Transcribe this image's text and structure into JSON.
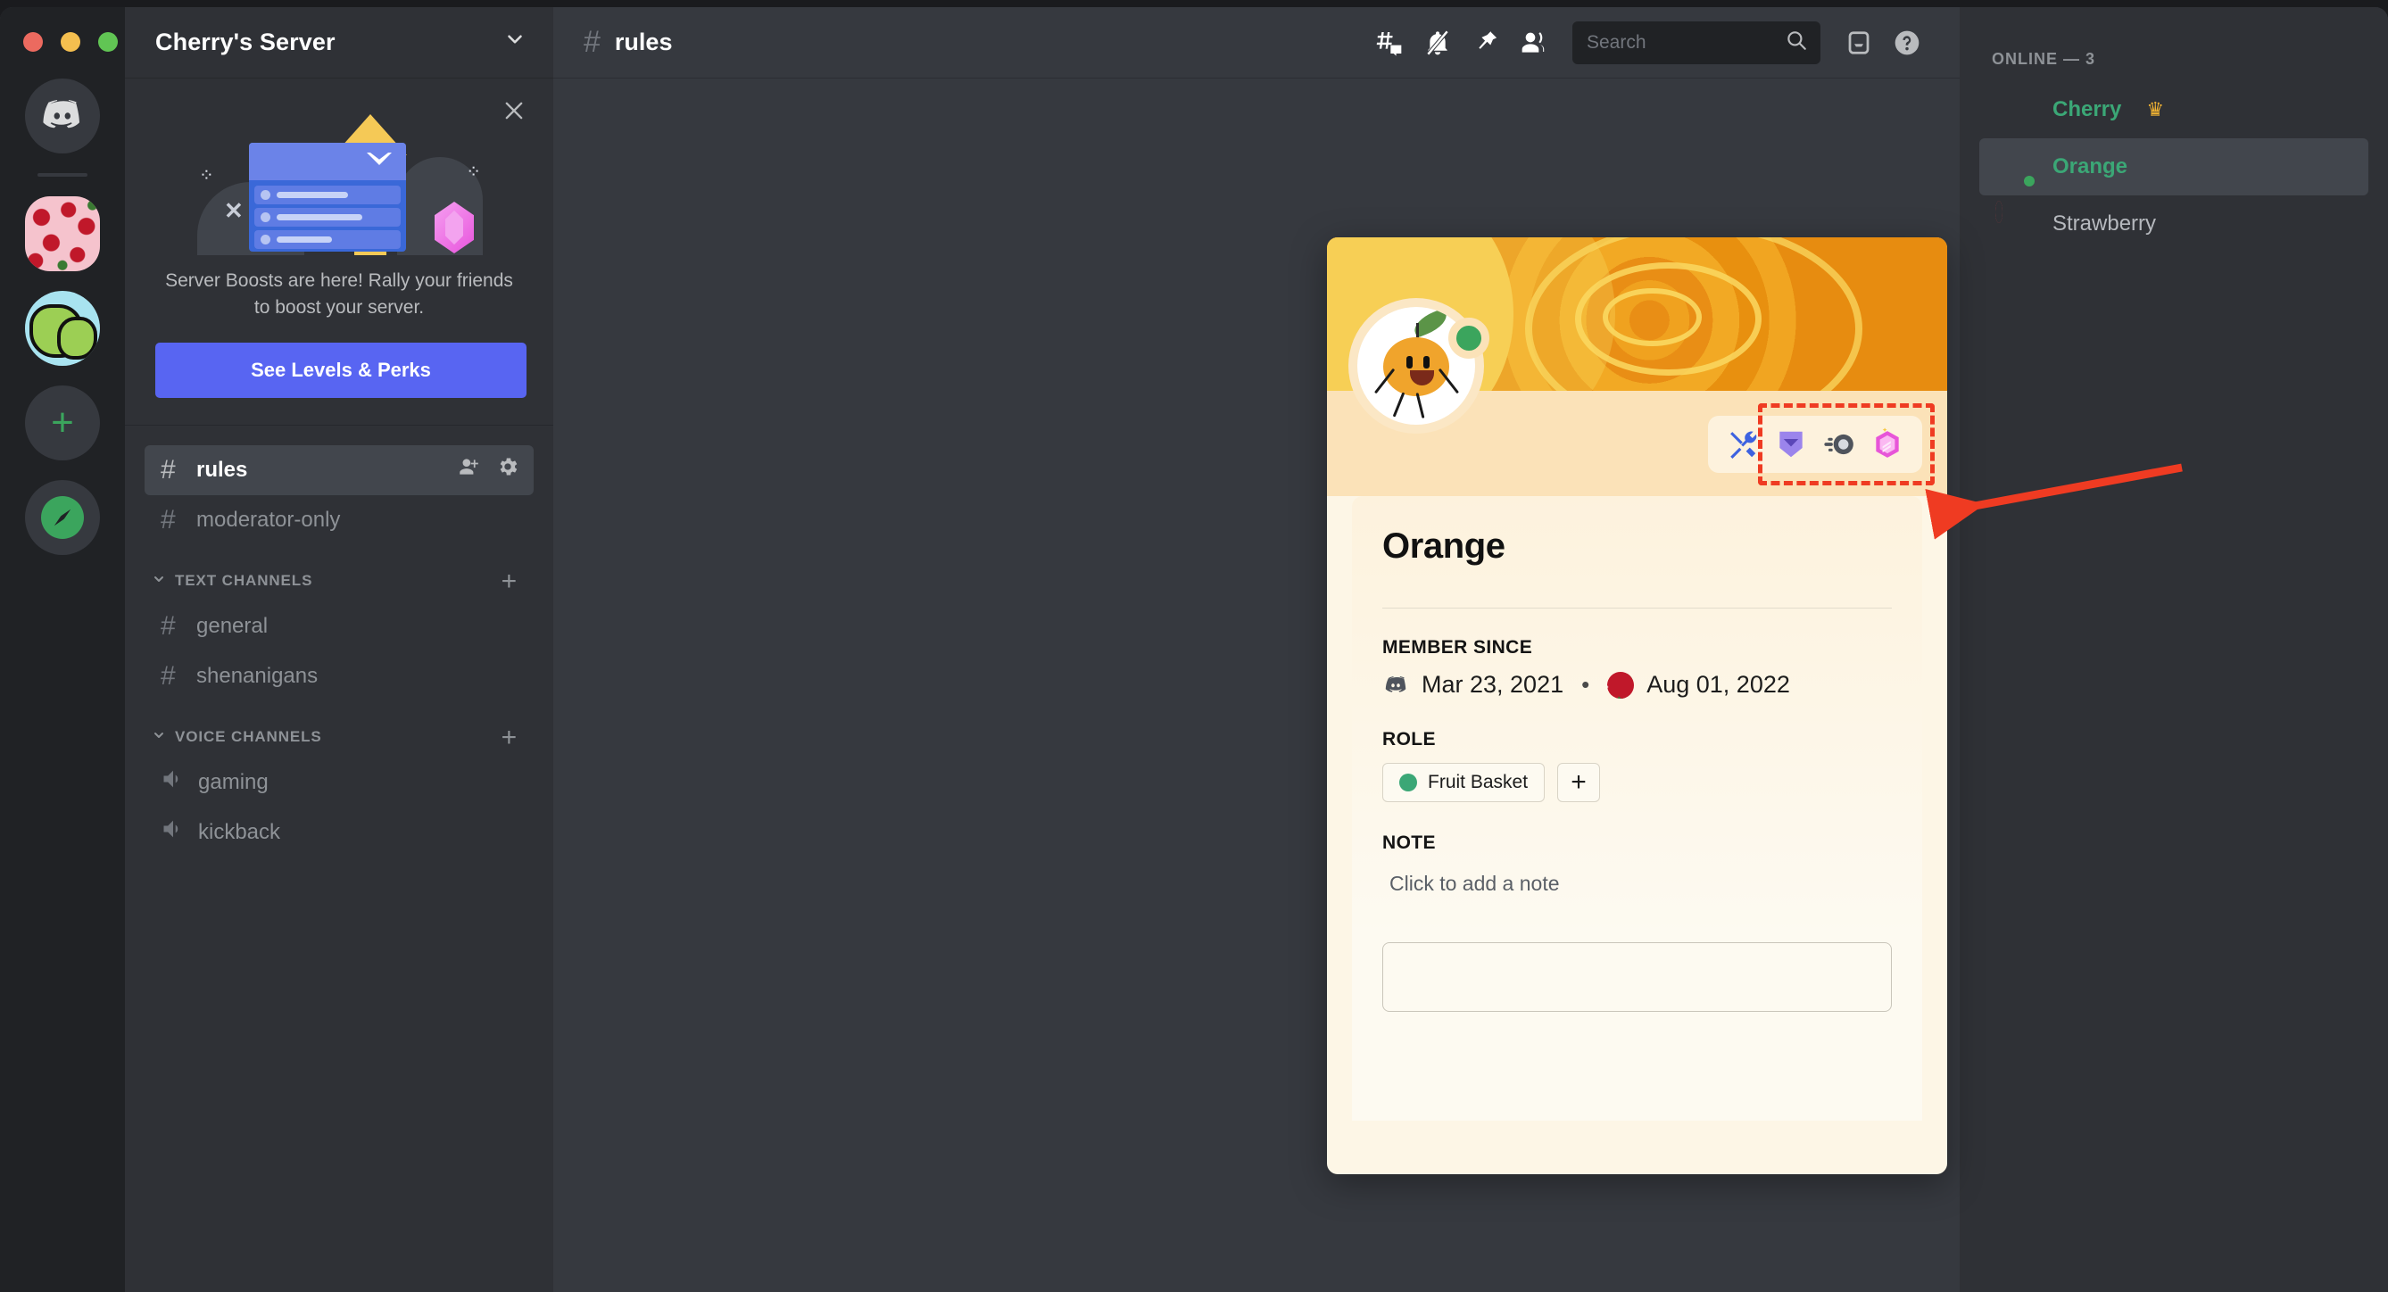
{
  "window": {
    "traffic_lights": [
      "close",
      "minimize",
      "zoom"
    ]
  },
  "server_rail": {
    "items": [
      {
        "name": "Discord Home",
        "icon": "discord-logo-icon"
      },
      {
        "name": "Cherry's Server",
        "icon": "cherry-server-icon"
      },
      {
        "name": "Orchard Server",
        "icon": "tree-server-icon"
      },
      {
        "name": "Add a Server",
        "icon": "plus-icon"
      },
      {
        "name": "Explore Public Servers",
        "icon": "compass-icon"
      }
    ]
  },
  "sidebar": {
    "server_name": "Cherry's Server",
    "dropdown_icon": "chevron-down-icon",
    "boost": {
      "close_icon": "close-icon",
      "text": "Server Boosts are here! Rally your friends to boost your server.",
      "button_label": "See Levels & Perks"
    },
    "top_channels": [
      {
        "label": "rules",
        "icon": "hash-icon",
        "active": true,
        "actions": [
          "add-member-icon",
          "gear-icon"
        ]
      },
      {
        "label": "moderator-only",
        "icon": "hash-lock-icon",
        "active": false
      }
    ],
    "categories": [
      {
        "label": "TEXT CHANNELS",
        "collapse_icon": "chevron-down-icon",
        "add_icon": "plus-icon",
        "channels": [
          {
            "label": "general",
            "icon": "hash-icon"
          },
          {
            "label": "shenanigans",
            "icon": "hash-icon"
          }
        ]
      },
      {
        "label": "VOICE CHANNELS",
        "collapse_icon": "chevron-down-icon",
        "add_icon": "plus-icon",
        "channels": [
          {
            "label": "gaming",
            "icon": "speaker-icon"
          },
          {
            "label": "kickback",
            "icon": "speaker-icon"
          }
        ]
      }
    ]
  },
  "topbar": {
    "hash_icon": "hash-icon",
    "channel_name": "rules",
    "icons": [
      "create-thread-icon",
      "notification-muted-icon",
      "pinned-messages-icon",
      "member-list-icon"
    ],
    "search": {
      "placeholder": "Search",
      "value": "",
      "icon": "search-icon"
    },
    "inbox_icon": "inbox-icon",
    "help_icon": "help-icon"
  },
  "members": {
    "header": "ONLINE — 3",
    "list": [
      {
        "name": "Cherry",
        "status": "online",
        "color": "#3ba776",
        "crown": "♛",
        "owner": true,
        "avatar": "cherries-avatar",
        "selected": false
      },
      {
        "name": "Orange",
        "status": "online",
        "color": "#3ba776",
        "owner": false,
        "avatar": "orange-avatar",
        "selected": true
      },
      {
        "name": "Strawberry",
        "status": "dnd",
        "color": "#b6b9be",
        "owner": false,
        "avatar": "strawberries-avatar",
        "selected": false
      }
    ]
  },
  "profile_card": {
    "banner": "orange-slice-banner",
    "avatar": "orange-character-avatar",
    "status": "online",
    "badges": [
      {
        "name": "active-developer-badge",
        "icon": "hammer-and-wrench-icon",
        "color": "#3d62e0"
      },
      {
        "name": "hypesquad-badge",
        "icon": "shield-chevron-icon",
        "color": "#9b84ec"
      },
      {
        "name": "bug-hunter-badge",
        "icon": "comet-icon",
        "color": "#4f545c"
      },
      {
        "name": "nitro-badge",
        "icon": "hexagon-gem-icon",
        "color": "#e755d8"
      }
    ],
    "display_name": "Orange",
    "member_since_label": "MEMBER SINCE",
    "discord_joined": "Mar 23, 2021",
    "separator": "•",
    "server_joined": "Aug 01, 2022",
    "role_label": "ROLE",
    "roles": [
      {
        "name": "Fruit Basket",
        "color": "#3ba776"
      }
    ],
    "add_role_label": "+",
    "note_label": "NOTE",
    "note_placeholder": "Click to add a note",
    "message_placeholder": ""
  },
  "annotation": {
    "highlight_target": "profile-badges-row",
    "color": "#ef3b22",
    "arrow": {
      "from": [
        2445,
        516
      ],
      "to": [
        2153,
        570
      ]
    }
  },
  "colors": {
    "accent": "#5865f2",
    "online": "#3ba55d",
    "dnd": "#ed4245",
    "card_bg": "#fdf6e6",
    "banner": "#e8900f",
    "annotation": "#ef3b22",
    "sidebar_bg": "#2f3136",
    "rail_bg": "#202225",
    "main_bg": "#36393f"
  }
}
